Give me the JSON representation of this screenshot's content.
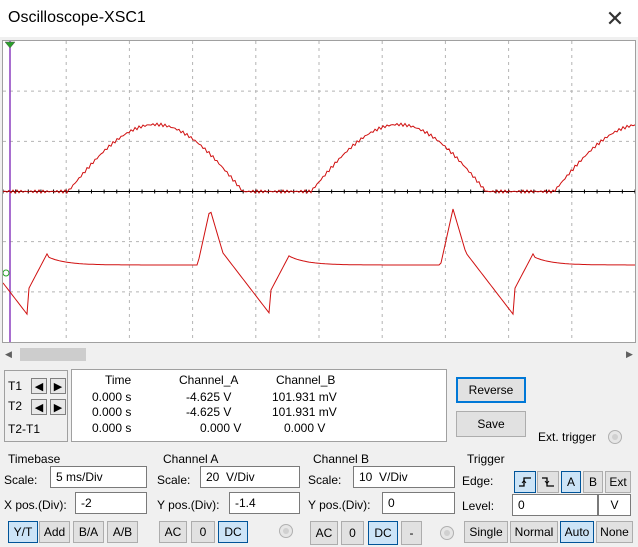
{
  "window": {
    "title": "Oscilloscope-XSC1",
    "close_glyph": "✕"
  },
  "screen": {
    "background": "#ffffff",
    "trace_color": "#d01010",
    "grid_color": "#b4b4b4",
    "cursor_color": "#8c3fbf"
  },
  "cursors": {
    "t1_label": "T1",
    "t2_label": "T2",
    "diff_label": "T2-T1"
  },
  "readout": {
    "headers": [
      "Time",
      "Channel_A",
      "Channel_B"
    ],
    "rows": [
      [
        "0.000 s",
        "-4.625 V",
        "101.931 mV"
      ],
      [
        "0.000 s",
        "-4.625 V",
        "101.931 mV"
      ],
      [
        "0.000 s",
        "0.000 V",
        "0.000 V"
      ]
    ]
  },
  "buttons": {
    "reverse": "Reverse",
    "save": "Save",
    "ext_trigger": "Ext. trigger"
  },
  "timebase": {
    "title": "Timebase",
    "scale_label": "Scale:",
    "scale_value": "5 ms/Div",
    "xpos_label": "X pos.(Div):",
    "xpos_value": "-2",
    "modes": [
      "Y/T",
      "Add",
      "B/A",
      "A/B"
    ]
  },
  "channel_a": {
    "title": "Channel A",
    "scale_label": "Scale:",
    "scale_value": "20  V/Div",
    "ypos_label": "Y pos.(Div):",
    "ypos_value": "-1.4",
    "coupling": [
      "AC",
      "0",
      "DC"
    ]
  },
  "channel_b": {
    "title": "Channel B",
    "scale_label": "Scale:",
    "scale_value": "10  V/Div",
    "ypos_label": "Y pos.(Div):",
    "ypos_value": "0",
    "coupling": [
      "AC",
      "0",
      "DC",
      "-"
    ]
  },
  "trigger": {
    "title": "Trigger",
    "edge_label": "Edge:",
    "sources": [
      "A",
      "B",
      "Ext"
    ],
    "level_label": "Level:",
    "level_value": "0",
    "level_unit": "V",
    "modes": [
      "Single",
      "Normal",
      "Auto",
      "None"
    ]
  }
}
